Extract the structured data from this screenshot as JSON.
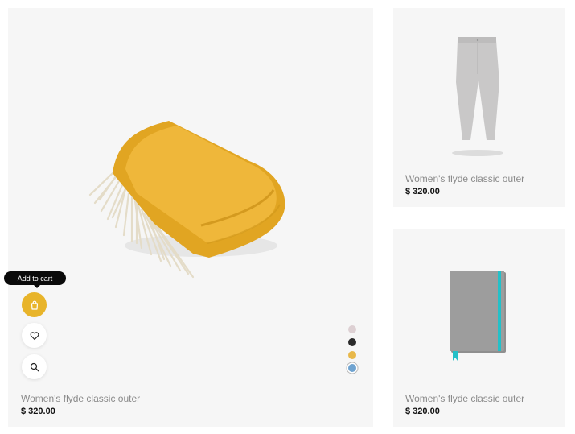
{
  "products": [
    {
      "name": "Women's flyde classic outer",
      "price": "$ 320.00"
    },
    {
      "name": "Women's flyde classic outer",
      "price": "$ 320.00"
    },
    {
      "name": "Women's flyde classic outer",
      "price": "$ 320.00"
    }
  ],
  "tooltip": {
    "add_to_cart": "Add to cart"
  },
  "actions": [
    "bag-icon",
    "heart-icon",
    "search-icon"
  ],
  "swatches": [
    {
      "color": "#ddd0d3",
      "selected": false
    },
    {
      "color": "#2b2b2b",
      "selected": false
    },
    {
      "color": "#e8b84a",
      "selected": false
    },
    {
      "color": "#6fa3d0",
      "selected": true
    }
  ],
  "colors": {
    "accent": "#e8b42a",
    "card_bg": "#f6f6f6"
  }
}
